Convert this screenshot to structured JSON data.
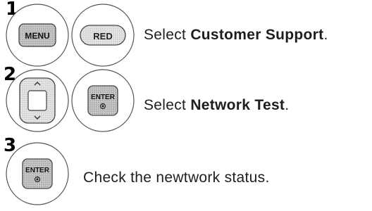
{
  "steps": [
    {
      "number": "1",
      "buttons": [
        {
          "label": "MENU",
          "icon": "menu-key-icon"
        },
        {
          "label": "RED",
          "icon": "red-key-icon"
        }
      ],
      "text_prefix": "Select ",
      "text_bold": "Customer Support",
      "text_suffix": "."
    },
    {
      "number": "2",
      "buttons": [
        {
          "label": "",
          "icon": "navigation-pad-icon"
        },
        {
          "label": "ENTER",
          "icon": "enter-key-icon"
        }
      ],
      "text_prefix": "Select ",
      "text_bold": "Network Test",
      "text_suffix": "."
    },
    {
      "number": "3",
      "buttons": [
        {
          "label": "ENTER",
          "icon": "enter-key-icon"
        }
      ],
      "text_prefix": "Check the newtwork status.",
      "text_bold": "",
      "text_suffix": ""
    }
  ]
}
